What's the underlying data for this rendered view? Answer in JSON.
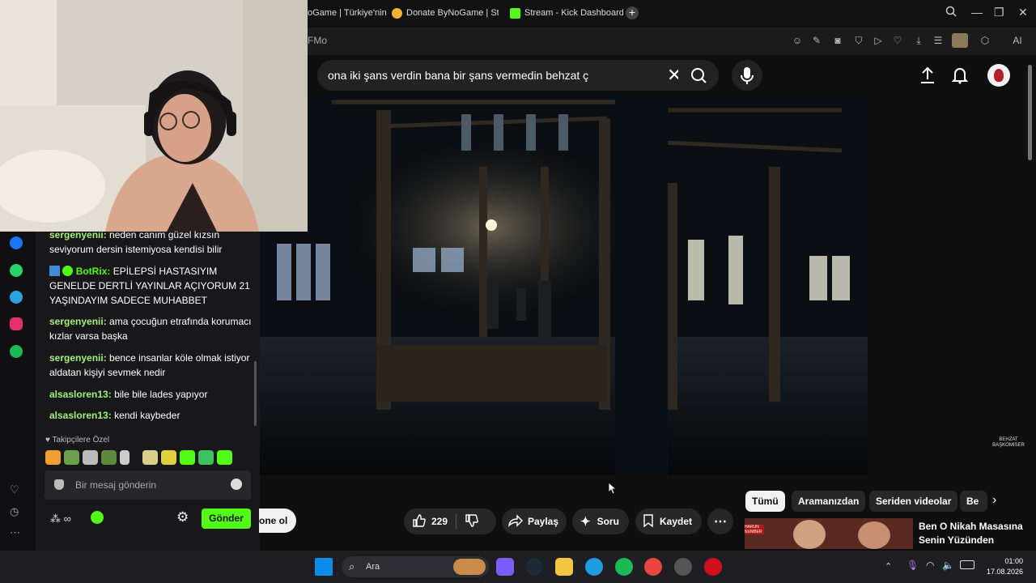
{
  "browser": {
    "tabs": [
      {
        "label": "oGame | Türkiye'nin E",
        "color": "#3a3a3a"
      },
      {
        "label": "Donate ByNoGame | Strea",
        "color": "#f2b233"
      },
      {
        "label": "Stream - Kick Dashboard",
        "color": "#53fc18"
      }
    ],
    "address": "FMo",
    "ai_label": "AI"
  },
  "youtube": {
    "search_query": "ona iki şans verdin bana bir şans vermedin behzat ç",
    "watermark": "BEHZAT BAŞKOMISER",
    "subscribe_label": "one ol",
    "actions": {
      "like_count": "229",
      "share": "Paylaş",
      "ask": "Soru",
      "save": "Kaydet"
    },
    "chips": [
      "Tümü",
      "Aramanızdan",
      "Seriden videolar",
      "Be"
    ],
    "suggested": {
      "title_line1": "Ben O Nikah Masasına",
      "title_line2": "Senin Yüzünden",
      "badge": "HARUN NUMBER"
    }
  },
  "chat": {
    "messages": [
      {
        "user": "sergenyenii:",
        "text": "neden canım güzel kızsın seviyorum dersin istemiyosa kendisi bilir"
      },
      {
        "user": "BotRix:",
        "text": "EPİLEPSİ HASTASIYIM GENELDE DERTLİ YAYINLAR AÇIYORUM 21 YAŞINDAYIM SADECE MUHABBET"
      },
      {
        "user": "sergenyenii:",
        "text": "ama çocuğun etrafında korumacı kızlar varsa başka"
      },
      {
        "user": "sergenyenii:",
        "text": "bence insanlar köle olmak istiyor aldatan kişiyi sevmek nedir"
      },
      {
        "user": "alsasloren13:",
        "text": "bile bile lades yapıyor"
      },
      {
        "user": "alsasloren13:",
        "text": "kendi kaybeder"
      }
    ],
    "emote_label": "Takipçilere Özel",
    "input_placeholder": "Bir mesaj gönderin",
    "send_label": "Gönder"
  },
  "taskbar": {
    "search_label": "Ara",
    "time": "01:00",
    "date": "17.08.2026"
  },
  "colors": {
    "kick_green": "#53fc18",
    "chat_user": "#a4f07c"
  }
}
